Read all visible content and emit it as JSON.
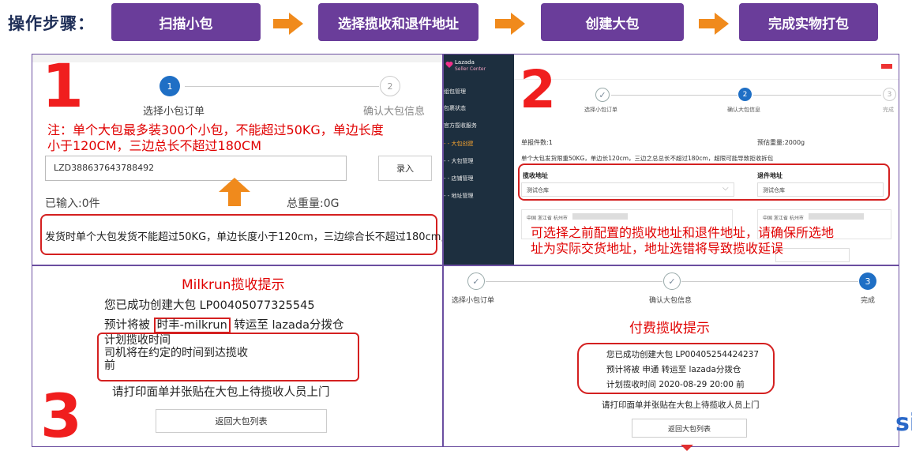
{
  "header": {
    "title": "操作步骤：",
    "steps": [
      "扫描小包",
      "选择揽收和退件地址",
      "创建大包",
      "完成实物打包"
    ]
  },
  "panel1": {
    "number": "1",
    "step1_num": "1",
    "step1_label": "选择小包订单",
    "step2_num": "2",
    "step2_label": "确认大包信息",
    "note_line1": "注：单个大包最多装300个小包，不能超过50KG，单边长度",
    "note_line2": "小于120CM，三边总长不超过180CM",
    "input_value": "LZD388637643788492",
    "enter_button": "录入",
    "entered_count": "已输入:0件",
    "total_weight": "总重量:0G",
    "warning": "发货时单个大包发货不能超过50KG，单边长度小于120cm，三边综合长不超过180cm,"
  },
  "panel2": {
    "number": "2",
    "brand": "Lazada",
    "brand_sub": "Seller Center",
    "sidebar": [
      "组包管理",
      "包裹状态",
      "官方揽收服务",
      "- - 大包创建",
      "- - 大包管理",
      "- - 店铺管理",
      "- - 地址管理"
    ],
    "step1_label": "选择小包订单",
    "step2_num": "2",
    "step2_label": "确认大包信息",
    "step3_num": "3",
    "step3_label": "完成",
    "package_count": "单报件数:1",
    "est_weight": "预估重量:2000g",
    "limit_note": "单个大包发货限重50KG，单边长120cm，三边之总总长不超过180cm，超限可能导致拒收拆包",
    "pickup_label": "揽收地址",
    "pickup_value": "测试仓库",
    "return_label": "退件地址",
    "return_value": "测试仓库",
    "addr1": "中国 浙江省 杭州市",
    "addr2": "中国 浙江省 杭州市",
    "tip_line1": "可选择之前配置的揽收地址和退件地址，请确保所选地",
    "tip_line2": "址为实际交货地址，地址选错将导致揽收延误"
  },
  "panel3": {
    "number": "3",
    "title": "Milkrun揽收提示",
    "line1": "您已成功创建大包 LP00405077325545",
    "line2_pre": "预计将被",
    "line2_carrier": "时丰-milkrun",
    "line2_post": "转运至 lazada分拨仓",
    "sched1": "计划揽收时间",
    "sched2": "司机将在约定的时间到达揽收",
    "sched3": "前",
    "print_note": "请打印面单并张贴在大包上待揽收人员上门",
    "back_button": "返回大包列表"
  },
  "panel4": {
    "step1_label": "选择小包订单",
    "step2_label": "确认大包信息",
    "step3_num": "3",
    "step3_label": "完成",
    "title": "付费揽收提示",
    "line1": "您已成功创建大包 LP00405254424237",
    "line2": "预计将被 申通 转运至 lazada分拨仓",
    "line3": "计划揽收时间 2020-08-29 20:00 前",
    "print_note": "请打印面单并张贴在大包上待揽收人员上门",
    "back_button": "返回大包列表"
  },
  "edge_text": "si",
  "colors": {
    "purple": "#6a3d9a",
    "orange": "#f08a1c",
    "red": "#e00000",
    "blue": "#1f6fc5",
    "sidebar": "#1d2f3f"
  }
}
